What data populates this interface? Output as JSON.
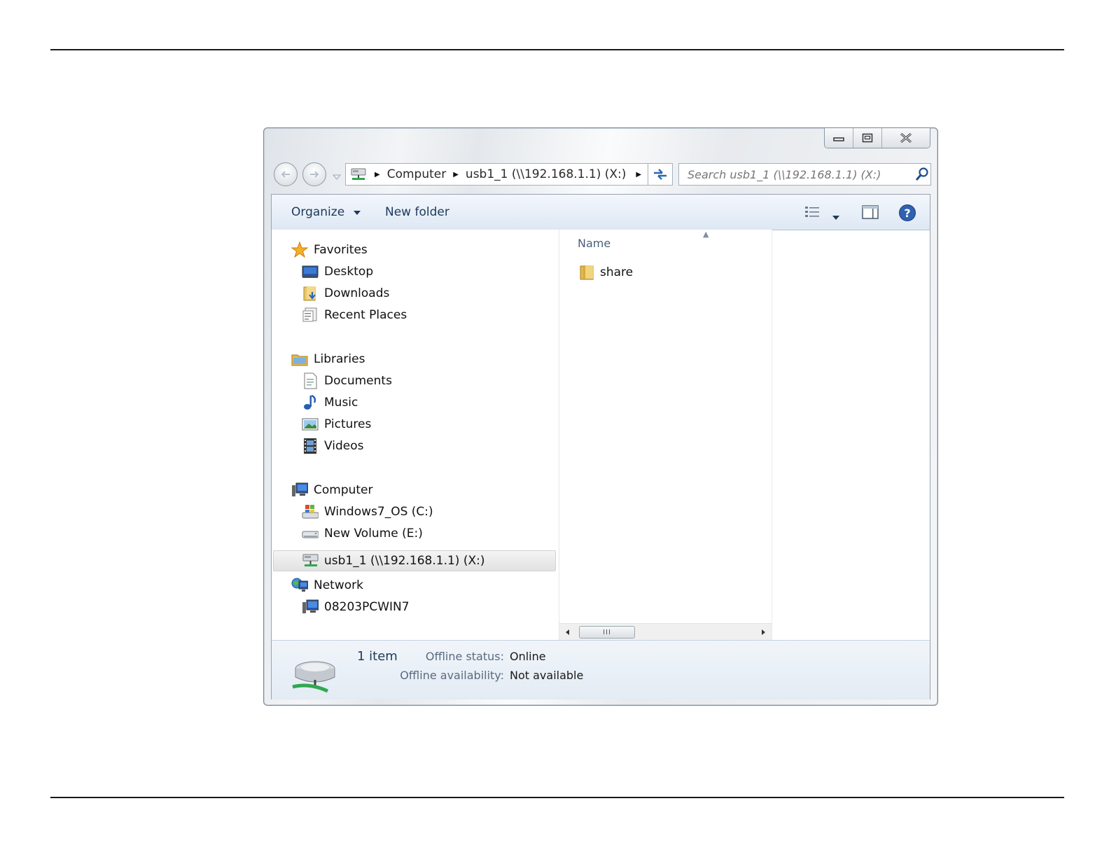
{
  "window": {
    "caption_buttons": [
      "minimize",
      "maximize",
      "close"
    ]
  },
  "address_bar": {
    "icon": "network-drive-icon",
    "segments": [
      "Computer",
      "usb1_1 (\\\\192.168.1.1) (X:)"
    ]
  },
  "search": {
    "placeholder": "Search usb1_1 (\\\\192.168.1.1) (X:)"
  },
  "command_bar": {
    "organize": "Organize",
    "new_folder": "New folder"
  },
  "nav_pane": {
    "favorites": {
      "label": "Favorites",
      "items": [
        "Desktop",
        "Downloads",
        "Recent Places"
      ]
    },
    "libraries": {
      "label": "Libraries",
      "items": [
        "Documents",
        "Music",
        "Pictures",
        "Videos"
      ]
    },
    "computer": {
      "label": "Computer",
      "items": [
        "Windows7_OS (C:)",
        "New Volume (E:)",
        "usb1_1 (\\\\192.168.1.1) (X:)"
      ],
      "selected": "usb1_1 (\\\\192.168.1.1) (X:)"
    },
    "network": {
      "label": "Network",
      "items": [
        "08203PCWIN7"
      ]
    }
  },
  "file_list": {
    "column_name": "Name",
    "items": [
      {
        "name": "share",
        "type": "folder"
      }
    ]
  },
  "details_pane": {
    "count": "1 item",
    "offline_status_label": "Offline status:",
    "offline_status_value": "Online",
    "offline_availability_label": "Offline availability:",
    "offline_availability_value": "Not available"
  },
  "colors": {
    "accent": "#1e395b",
    "selection": "#e6e6e6"
  }
}
